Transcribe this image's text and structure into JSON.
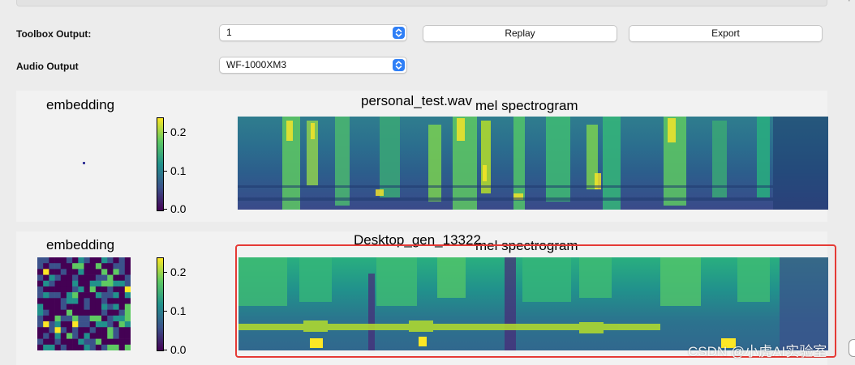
{
  "toolbox": {
    "output_label": "Toolbox Output:",
    "output_value": "1",
    "replay_label": "Replay",
    "export_label": "Export"
  },
  "audio": {
    "output_label": "Audio Output",
    "output_value": "WF-1000XM3"
  },
  "panels": [
    {
      "embedding_title": "embedding",
      "spec_title": "personal_test.wav",
      "spec_subtitle": "mel spectrogram",
      "colorbar_ticks": [
        "0.2",
        "0.1",
        "0.0"
      ]
    },
    {
      "embedding_title": "embedding",
      "spec_title": "Desktop_gen_13322",
      "spec_subtitle": "mel spectrogram",
      "colorbar_ticks": [
        "0.2",
        "0.1",
        "0.0"
      ]
    }
  ],
  "colors": {
    "highlight": "#e53a35",
    "accent": "#2f7ff6",
    "viridis": [
      "#440154",
      "#3b528b",
      "#21918c",
      "#5ec962",
      "#fde725"
    ]
  },
  "watermark": "CSDN @小虎AI实验室"
}
